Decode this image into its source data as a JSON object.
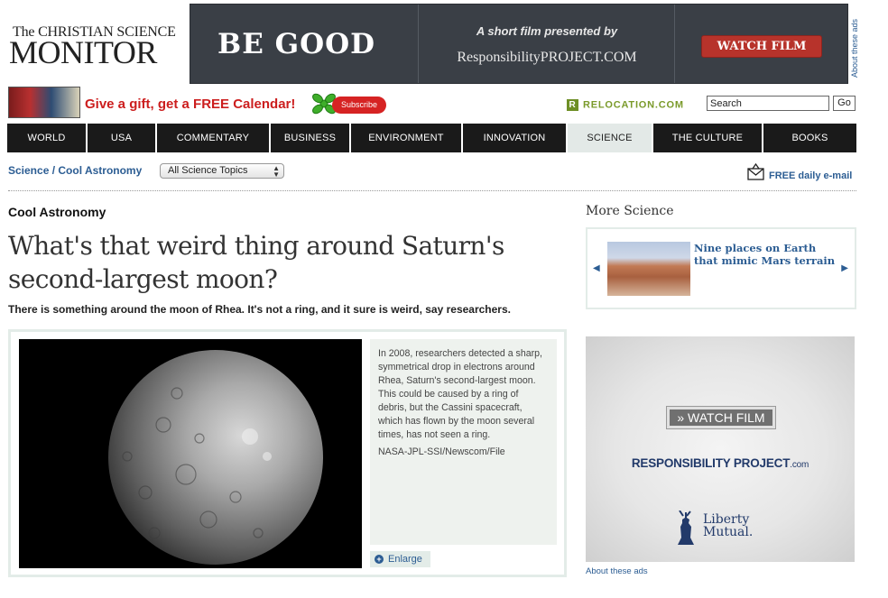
{
  "header": {
    "logo_line1": "The CHRISTIAN SCIENCE",
    "logo_line2": "MONITOR",
    "top_ad": {
      "headline": "BE GOOD",
      "subtitle": "A short film presented by",
      "brand": "ResponsibilityPROJECT.COM",
      "button": "WATCH FILM",
      "about_label": "About these ads"
    },
    "gift": {
      "text": "Give a gift, get a FREE Calendar!",
      "subscribe": "Subscribe"
    },
    "relocation": "RELOCATION.COM",
    "search": {
      "value": "Search",
      "button": "Go"
    }
  },
  "nav": {
    "items": [
      {
        "label": "WORLD",
        "width": 0
      },
      {
        "label": "USA"
      },
      {
        "label": "COMMENTARY"
      },
      {
        "label": "BUSINESS"
      },
      {
        "label": "ENVIRONMENT"
      },
      {
        "label": "INNOVATION"
      },
      {
        "label": "SCIENCE"
      },
      {
        "label": "THE CULTURE"
      },
      {
        "label": "BOOKS"
      }
    ],
    "active": "SCIENCE"
  },
  "breadcrumb": {
    "section": "Science",
    "separator": " / ",
    "subsection": "Cool Astronomy",
    "topics_select": "All Science Topics",
    "email": "FREE daily e-mail"
  },
  "article": {
    "kicker": "Cool Astronomy",
    "headline": "What's that weird thing around Saturn's second-largest moon?",
    "deck": "There is something around the moon of Rhea. It's not a ring, and it sure is weird, say researchers.",
    "caption": "In 2008, researchers detected a sharp, symmetrical drop in electrons around Rhea, Saturn's second-largest moon. This could be caused by a ring of debris, but the Cassini spacecraft, which has flown by the moon several times, has not seen a ring.",
    "credit": "NASA-JPL-SSI/Newscom/File",
    "enlarge": "Enlarge"
  },
  "sidebar": {
    "more_title": "More Science",
    "promo_title": "Nine places on Earth that mimic Mars terrain",
    "ad": {
      "watch": "» WATCH FILM",
      "brand": "RESPONSIBILITY PROJECT",
      "brand_suffix": ".com",
      "sponsor_line1": "Liberty",
      "sponsor_line2": "Mutual."
    },
    "about_ads": "About these ads"
  }
}
